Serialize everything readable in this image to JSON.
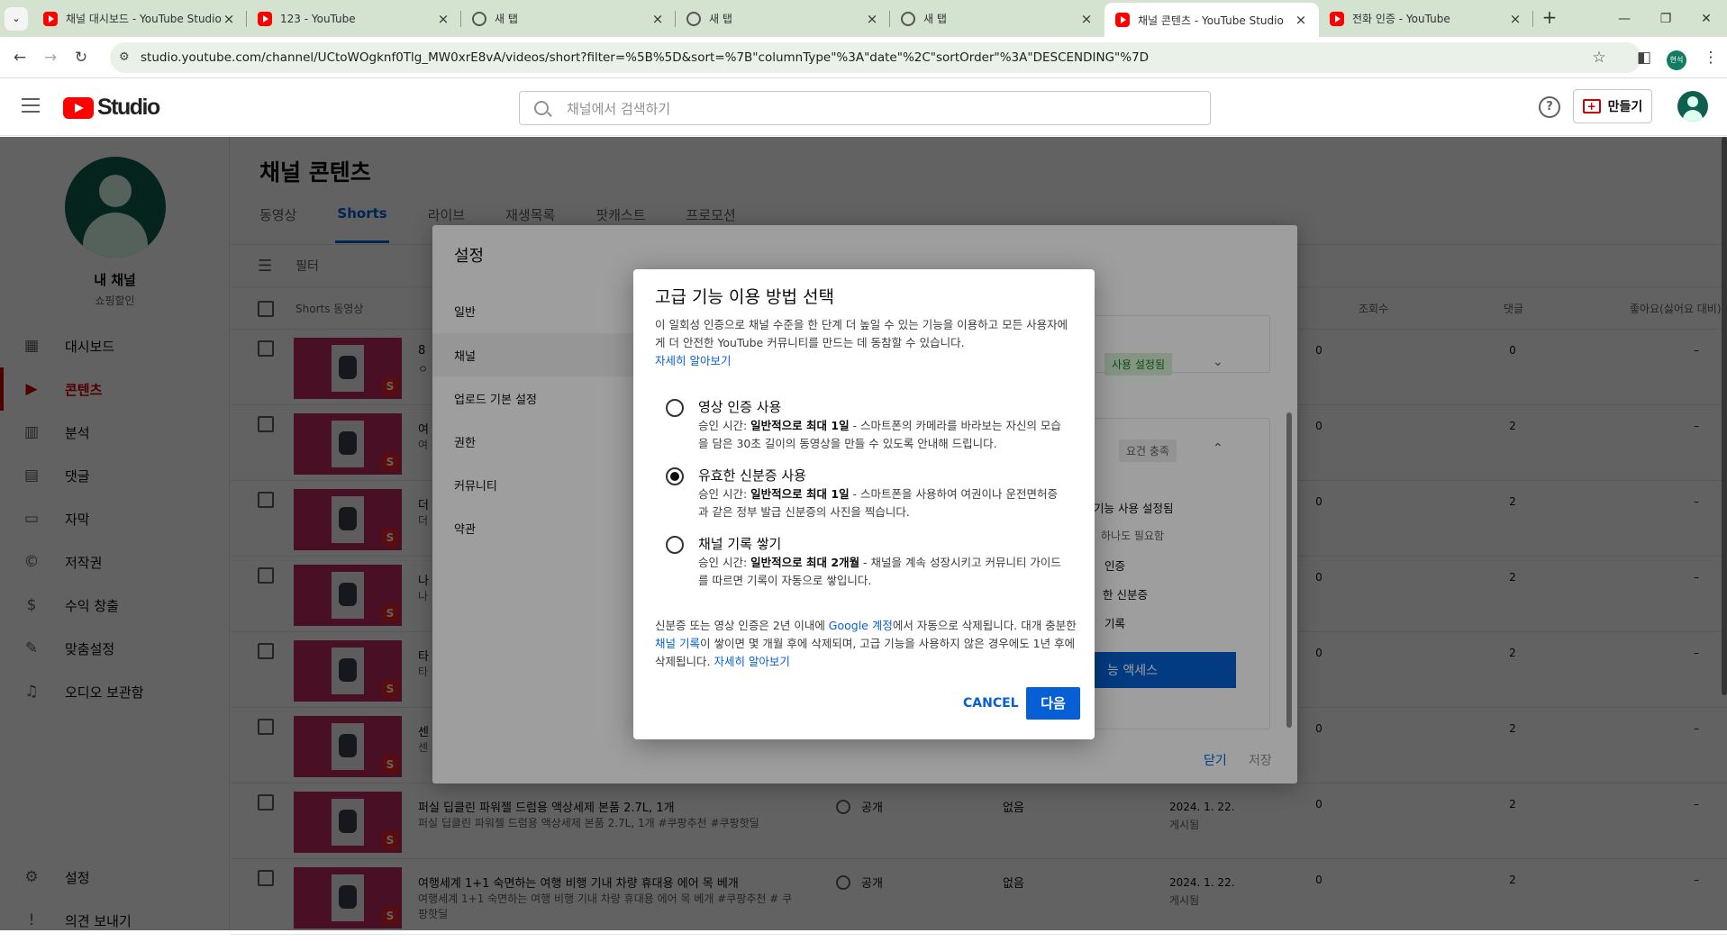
{
  "browser": {
    "tabs": [
      {
        "title": "채널 대시보드 - YouTube Studio",
        "icon": "youtube-favicon"
      },
      {
        "title": "123 - YouTube",
        "icon": "youtube-favicon"
      },
      {
        "title": "새 탭",
        "icon": "globe-icon"
      },
      {
        "title": "새 탭",
        "icon": "globe-icon"
      },
      {
        "title": "새 탭",
        "icon": "globe-icon"
      },
      {
        "title": "채널 콘텐츠 - YouTube Studio",
        "icon": "youtube-favicon",
        "active": true
      },
      {
        "title": "전화 인증 - YouTube",
        "icon": "youtube-favicon"
      }
    ],
    "url": "studio.youtube.com/channel/UCtoWOgknf0Tlg_MW0xrE8vA/videos/short?filter=%5B%5D&sort=%7B\"columnType\"%3A\"date\"%2C\"sortOrder\"%3A\"DESCENDING\"%7D",
    "profile_initials": "현석"
  },
  "header": {
    "logo_text": "Studio",
    "search_placeholder": "채널에서 검색하기",
    "help": "?",
    "create_label": "만들기"
  },
  "sidebar": {
    "channel_name": "내 채널",
    "channel_sub": "쇼핑할인",
    "items": [
      {
        "label": "대시보드",
        "icon": "dashboard-icon"
      },
      {
        "label": "콘텐츠",
        "icon": "content-icon",
        "active": true
      },
      {
        "label": "분석",
        "icon": "analytics-icon"
      },
      {
        "label": "댓글",
        "icon": "comments-icon"
      },
      {
        "label": "자막",
        "icon": "subtitles-icon"
      },
      {
        "label": "저작권",
        "icon": "copyright-icon"
      },
      {
        "label": "수익 창출",
        "icon": "monetization-icon"
      },
      {
        "label": "맞춤설정",
        "icon": "customization-icon"
      },
      {
        "label": "오디오 보관함",
        "icon": "audio-library-icon"
      }
    ],
    "bottom": [
      {
        "label": "설정",
        "icon": "settings-icon"
      },
      {
        "label": "의견 보내기",
        "icon": "feedback-icon"
      }
    ]
  },
  "content": {
    "title": "채널 콘텐츠",
    "tabs": [
      "동영상",
      "Shorts",
      "라이브",
      "재생목록",
      "팟캐스트",
      "프로모션"
    ],
    "active_tab": "Shorts",
    "filter_label": "필터",
    "columns": {
      "video": "Shorts 동영상",
      "views": "조회수",
      "comments": "댓글",
      "likes": "좋아요(싫어요 대비)"
    },
    "rows": [
      {
        "title": "8",
        "desc": "ㅇ",
        "visibility": "",
        "restriction": "",
        "date": "",
        "date_status": "",
        "views": "0",
        "comments": "0",
        "likes": "–"
      },
      {
        "title": "여",
        "desc": "여\n쿠",
        "visibility": "",
        "restriction": "",
        "date": "",
        "date_status": "",
        "views": "0",
        "comments": "2",
        "likes": "–"
      },
      {
        "title": "더",
        "desc": "더",
        "visibility": "",
        "restriction": "",
        "date": "",
        "date_status": "",
        "views": "0",
        "comments": "2",
        "likes": "–"
      },
      {
        "title": "나",
        "desc": "나",
        "visibility": "",
        "restriction": "",
        "date": "",
        "date_status": "",
        "views": "0",
        "comments": "2",
        "likes": "–"
      },
      {
        "title": "타",
        "desc": "타",
        "visibility": "",
        "restriction": "",
        "date": "",
        "date_status": "",
        "views": "0",
        "comments": "2",
        "likes": "–"
      },
      {
        "title": "센",
        "desc": "센",
        "visibility": "",
        "restriction": "",
        "date": "",
        "date_status": "",
        "views": "0",
        "comments": "2",
        "likes": "–"
      },
      {
        "title": "퍼실 딥클린 파워젤 드럼용 액상세제 본품 2.7L, 1개",
        "desc": "퍼실 딥클린 파워젤 드럼용 액상세제 본품 2.7L, 1개 #쿠팡추천 #쿠팡핫딜",
        "visibility": "공개",
        "restriction": "없음",
        "date": "2024. 1. 22.",
        "date_status": "게시됨",
        "views": "0",
        "comments": "2",
        "likes": "–"
      },
      {
        "title": "여행세계 1+1 숙면하는 여행 비행 기내 차량 휴대용 에어 목 베개",
        "desc": "여행세계 1+1 숙면하는 여행 비행 기내 차량 휴대용 에어 목 베개 #쿠팡추천 # 쿠팡핫딜",
        "visibility": "공개",
        "restriction": "없음",
        "date": "2024. 1. 22.",
        "date_status": "게시됨",
        "views": "0",
        "comments": "2",
        "likes": "–"
      }
    ]
  },
  "settings_dialog": {
    "title": "설정",
    "nav": [
      "일반",
      "채널",
      "업로드 기본 설정",
      "권한",
      "커뮤니티",
      "약관"
    ],
    "selected_nav": "채널",
    "chip_enabled": "사용 설정됨",
    "chip_requirements": "요건 충족",
    "feature_enabled": "기능 사용 설정됨",
    "one_required": "하나도 필요함",
    "req1": "인증",
    "req2": "한 신분증",
    "req3": "기록",
    "access_button": "능 액세스",
    "close": "닫기",
    "save": "저장"
  },
  "dialog": {
    "title": "고급 기능 이용 방법 선택",
    "intro": "이 일회성 인증으로 채널 수준을 한 단계 더 높일 수 있는 기능을 이용하고 모든 사용자에게 더 안전한 YouTube 커뮤니티를 만드는 데 동참할 수 있습니다.",
    "intro_link": "자세히 알아보기",
    "options": [
      {
        "label": "영상 인증 사용",
        "time_prefix": "승인 시간: ",
        "time": "일반적으로 최대 1일",
        "desc": " - 스마트폰의 카메라를 바라보는 자신의 모습을 담은 30초 길이의 동영상을 만들 수 있도록 안내해 드립니다.",
        "selected": false
      },
      {
        "label": "유효한 신분증 사용",
        "time_prefix": "승인 시간: ",
        "time": "일반적으로 최대 1일",
        "desc": " - 스마트폰을 사용하여 여권이나 운전면허증과 같은 정부 발급 신분증의 사진을 찍습니다.",
        "selected": true
      },
      {
        "label": "채널 기록 쌓기",
        "time_prefix": "승인 시간: ",
        "time": "일반적으로 최대 2개월",
        "desc": " - 채널을 계속 성장시키고 커뮤니티 가이드를 따르면 기록이 자동으로 쌓입니다.",
        "selected": false
      }
    ],
    "footer_1": "신분증 또는 영상 인증은 2년 이내에 ",
    "footer_link1": "Google 계정",
    "footer_2": "에서 자동으로 삭제됩니다. 대개 충분한 ",
    "footer_link2": "채널 기록",
    "footer_3": "이 쌓이면 몇 개월 후에 삭제되며, 고급 기능을 사용하지 않은 경우에도 1년 후에 삭제됩니다. ",
    "footer_link3": "자세히 알아보기",
    "cancel": "CANCEL",
    "next": "다음"
  }
}
